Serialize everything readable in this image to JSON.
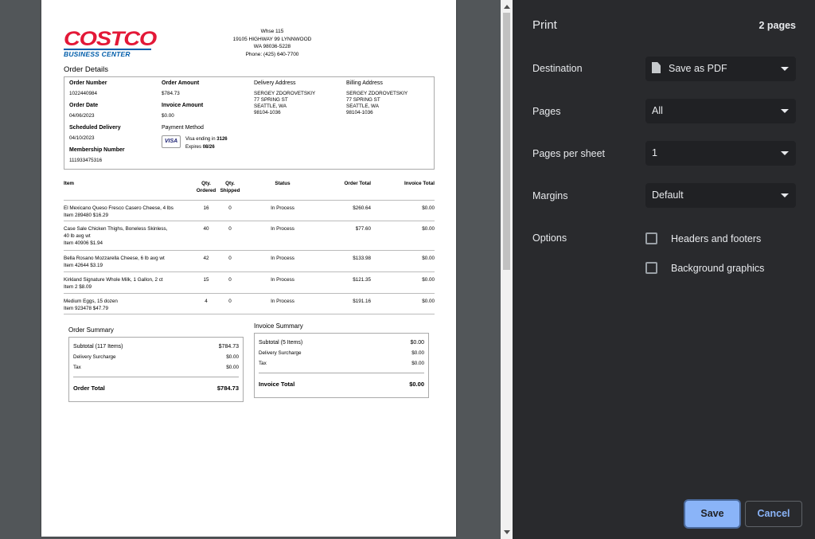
{
  "document": {
    "logo": {
      "brand": "COSTCO",
      "sub": "BUSINESS CENTER"
    },
    "warehouse": [
      "Whse 115",
      "19105 HIGHWAY 99 LYNNWOOD",
      "WA 98036-5228",
      "Phone: (425) 640-7700"
    ],
    "order_details_title": "Order Details",
    "order_number_label": "Order Number",
    "order_number": "1022440984",
    "order_date_label": "Order Date",
    "order_date": "04/06/2023",
    "scheduled_delivery_label": "Scheduled Delivery",
    "scheduled_delivery": "04/10/2023",
    "membership_label": "Membership Number",
    "membership_number": "111933475316",
    "order_amount_label": "Order Amount",
    "order_amount": "$784.73",
    "invoice_amount_label": "Invoice Amount",
    "invoice_amount": "$0.00",
    "payment_method_label": "Payment Method",
    "card_brand": "VISA",
    "card_ending_label": "Visa ending in",
    "card_ending": "3126",
    "expires_label": "Expires",
    "expires": "08/26",
    "delivery_address_label": "Delivery Address",
    "delivery_address": [
      "SERGEY ZDOROVETSKIY",
      "77 SPRING ST",
      "SEATTLE, WA",
      "98104-1036"
    ],
    "billing_address_label": "Billing Address",
    "billing_address": [
      "SERGEY ZDOROVETSKIY",
      "77 SPRING ST",
      "SEATTLE, WA",
      "98104-1036"
    ],
    "table_headers": {
      "item": "Item",
      "qty_ordered": [
        "Qty.",
        "Ordered"
      ],
      "qty_shipped": [
        "Qty.",
        "Shipped"
      ],
      "status": "Status",
      "order_total": "Order Total",
      "invoice_total": "Invoice Total"
    },
    "items": [
      {
        "lines": [
          "El Mexicano Queso Fresco Casero Cheese, 4 lbs",
          "Item 289480  $16.29"
        ],
        "ordered": "16",
        "shipped": "0",
        "status": "In Process",
        "order_total": "$260.64",
        "invoice_total": "$0.00"
      },
      {
        "lines": [
          "Case Sale Chicken Thighs, Boneless Skinless,",
          "40 lb avg wt",
          "Item 40906  $1.94"
        ],
        "ordered": "40",
        "shipped": "0",
        "status": "In Process",
        "order_total": "$77.60",
        "invoice_total": "$0.00"
      },
      {
        "lines": [
          "Bella Rosano Mozzarella Cheese, 6 lb avg wt",
          "Item 42644  $3.19"
        ],
        "ordered": "42",
        "shipped": "0",
        "status": "In Process",
        "order_total": "$133.98",
        "invoice_total": "$0.00"
      },
      {
        "lines": [
          "Kirkland Signature Whole Milk, 1 Gallon, 2 ct",
          "Item 2  $8.09"
        ],
        "ordered": "15",
        "shipped": "0",
        "status": "In Process",
        "order_total": "$121.35",
        "invoice_total": "$0.00"
      },
      {
        "lines": [
          "Medium Eggs, 15 dozen",
          "Item 923478  $47.79"
        ],
        "ordered": "4",
        "shipped": "0",
        "status": "In Process",
        "order_total": "$191.16",
        "invoice_total": "$0.00"
      }
    ],
    "order_summary": {
      "title": "Order Summary",
      "rows": [
        {
          "label": "Subtotal (117 Items)",
          "value": "$784.73"
        },
        {
          "label": "Delivery Surcharge",
          "value": "$0.00"
        },
        {
          "label": "Tax",
          "value": "$0.00"
        }
      ],
      "total_label": "Order Total",
      "total_value": "$784.73"
    },
    "invoice_summary": {
      "title": "Invoice Summary",
      "rows": [
        {
          "label": "Subtotal (5 Items)",
          "value": "$0.00"
        },
        {
          "label": "Delivery Surcharge",
          "value": "$0.00"
        },
        {
          "label": "Tax",
          "value": "$0.00"
        }
      ],
      "total_label": "Invoice Total",
      "total_value": "$0.00"
    }
  },
  "sidebar": {
    "title": "Print",
    "page_count": "2 pages",
    "destination_label": "Destination",
    "destination_value": "Save as PDF",
    "pages_label": "Pages",
    "pages_value": "All",
    "pps_label": "Pages per sheet",
    "pps_value": "1",
    "margins_label": "Margins",
    "margins_value": "Default",
    "options_label": "Options",
    "headers_footers": "Headers and footers",
    "background_graphics": "Background graphics",
    "save_button": "Save",
    "cancel_button": "Cancel",
    "colors": {
      "panel": "#292a2d",
      "accent": "#8ab4f8"
    }
  }
}
